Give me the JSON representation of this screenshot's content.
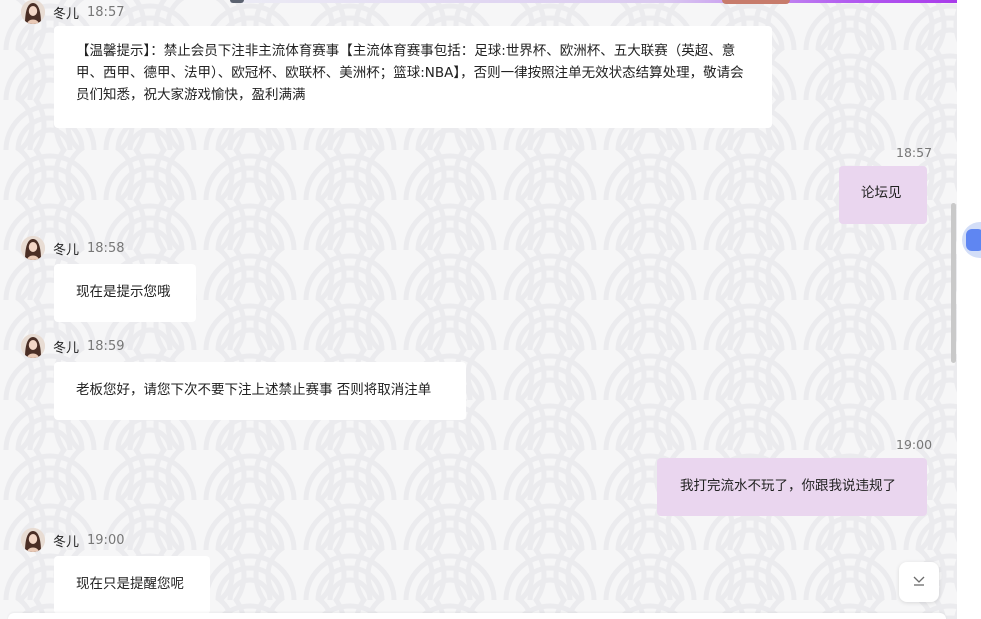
{
  "messages": [
    {
      "sender": "冬儿",
      "time": "18:57",
      "text": "【温馨提示】：禁止会员下注非主流体育赛事【主流体育赛事包括：足球:世界杯、欧洲杯、五大联赛（英超、意甲、西甲、德甲、法甲）、欧冠杯、欧联杯、美洲杯；篮球:NBA】，否则一律按照注单无效状态结算处理，敬请会员们知悉，祝大家游戏愉快，盈利满满"
    },
    {
      "sender": "me",
      "time": "18:57",
      "text": "论坛见"
    },
    {
      "sender": "冬儿",
      "time": "18:58",
      "text": "现在是提示您哦"
    },
    {
      "sender": "冬儿",
      "time": "18:59",
      "text": "老板您好，请您下次不要下注上述禁止赛事 否则将取消注单"
    },
    {
      "sender": "me",
      "time": "19:00",
      "text": "我打完流水不玩了，你跟我说违规了"
    },
    {
      "sender": "冬儿",
      "time": "19:00",
      "text": "现在只是提醒您呢"
    }
  ],
  "icons": {
    "agent_avatar": "avatar-icon",
    "scroll_down": "chevron-down-icon",
    "side_tab": "side-widget-icon"
  },
  "colors": {
    "incoming_bubble": "#ffffff",
    "outgoing_bubble": "#ead6ef",
    "background": "#f6f6f7",
    "accent": "#5f86f2"
  }
}
